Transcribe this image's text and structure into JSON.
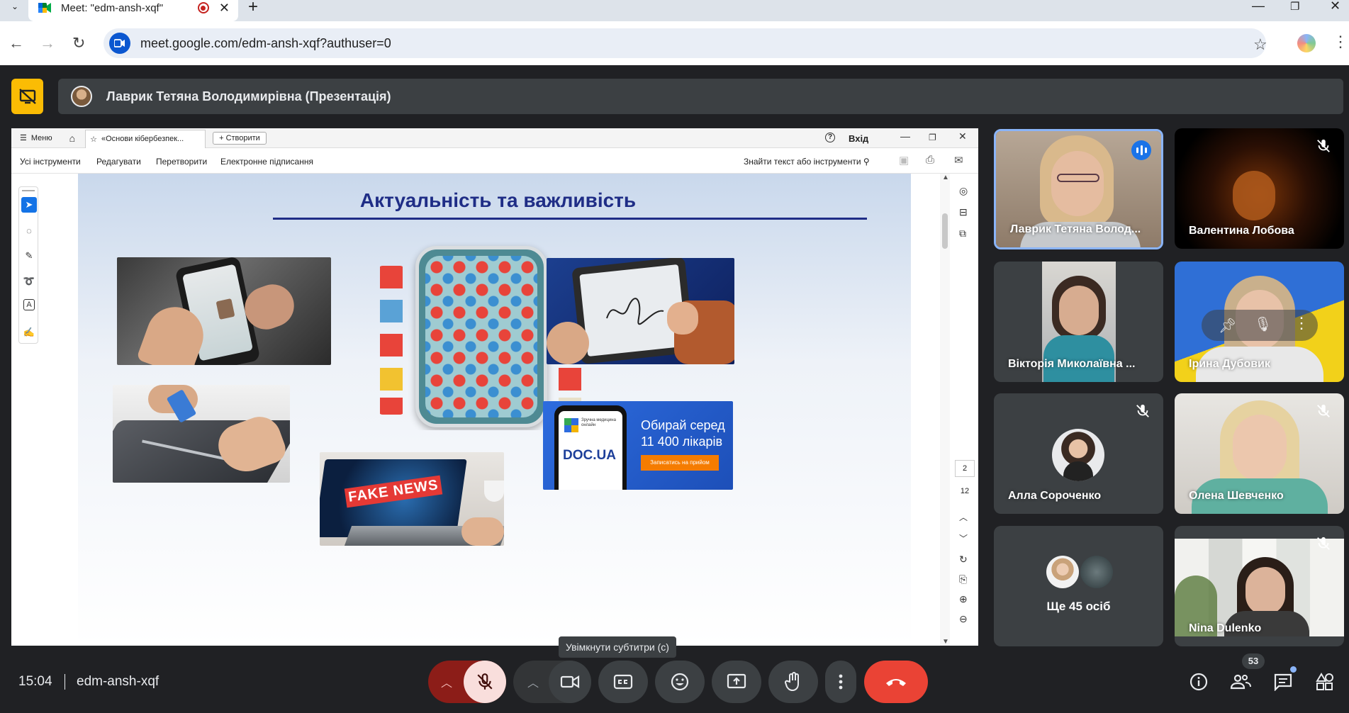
{
  "browser": {
    "tab_title": "Meet: \"edm-ansh-xqf\"",
    "new_tab": "+",
    "url": "meet.google.com/edm-ansh-xqf?authuser=0"
  },
  "presentation": {
    "presenter_label": "Лаврик Тетяна Володимирівна (Презентація)"
  },
  "pdf_viewer": {
    "menu_label": "Меню",
    "doc_tab": "«Основи кібербезпек...",
    "create_label": "Створити",
    "login_label": "Вхід",
    "toolbar": [
      "Усі інструменти",
      "Редагувати",
      "Перетворити",
      "Електронне підписання"
    ],
    "search_label": "Знайти текст або інструменти",
    "page_current": "2",
    "page_total": "12"
  },
  "slide": {
    "title": "Актуальність та важливість",
    "fake_news_text": "FAKE NEWS",
    "doc_ua": {
      "logo_caption": "Зручна медицина онлайн",
      "brand": "DOC.UA",
      "headline_1": "Обирай серед",
      "headline_2": "11 400 лікарів",
      "cta": "Записатись на прийом"
    }
  },
  "participants": [
    {
      "name": "Лаврик Тетяна Волод...",
      "speaking": true
    },
    {
      "name": "Валентина Лобова",
      "muted": true
    },
    {
      "name": "Вікторія Миколаївна ..."
    },
    {
      "name": "Ірина Дубовик"
    },
    {
      "name": "Алла Сороченко",
      "muted": true
    },
    {
      "name": "Олена Шевченко",
      "muted": true
    },
    {
      "name": "Ще 45 осіб"
    },
    {
      "name": "Nina Dulenko",
      "muted": true
    }
  ],
  "bottom_bar": {
    "time": "15:04",
    "meeting_code": "edm-ansh-xqf",
    "tooltip": "Увімкнути субтитри (c)",
    "people_count": "53"
  },
  "colors": {
    "meet_bg": "#202124",
    "tile_bg": "#3c4043",
    "hangup": "#ea4335",
    "present_stop": "#fbbc04",
    "mic_muted_bg": "#f9dedc",
    "accent": "#8ab4f8"
  }
}
